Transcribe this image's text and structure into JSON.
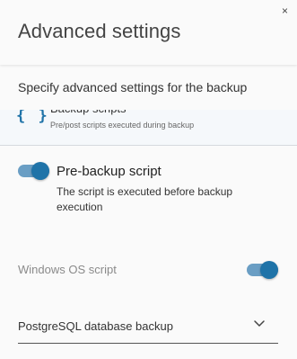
{
  "dialog": {
    "title": "Advanced settings",
    "close_label": "×",
    "subtitle": "Specify advanced settings for the backup"
  },
  "section": {
    "icon": "curly-braces-icon",
    "icon_glyph": "{ }",
    "title": "Backup scripts",
    "description": "Pre/post scripts executed during backup"
  },
  "pre_backup": {
    "label": "Pre-backup script",
    "description": "The script is executed before backup execution",
    "enabled": true
  },
  "windows_script": {
    "label": "Windows OS script",
    "enabled": true
  },
  "database_select": {
    "value": "PostgreSQL database backup"
  },
  "colors": {
    "accent": "#1f73a8",
    "toggle_track": "#6a9ec4",
    "section_bg": "#f5f8fb"
  }
}
